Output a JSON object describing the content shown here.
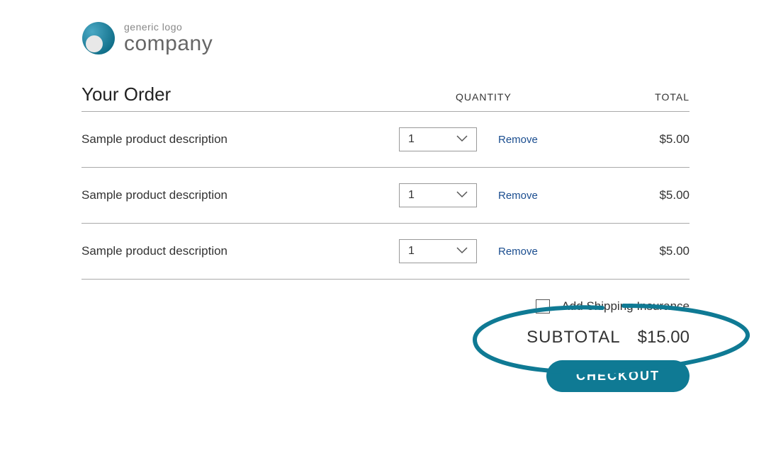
{
  "logo": {
    "small_text": "generic logo",
    "large_text": "company"
  },
  "header": {
    "title": "Your Order",
    "qty_col": "QUANTITY",
    "total_col": "TOTAL"
  },
  "rows": [
    {
      "desc": "Sample product description",
      "qty": "1",
      "remove": "Remove",
      "total": "$5.00"
    },
    {
      "desc": "Sample product description",
      "qty": "1",
      "remove": "Remove",
      "total": "$5.00"
    },
    {
      "desc": "Sample product description",
      "qty": "1",
      "remove": "Remove",
      "total": "$5.00"
    }
  ],
  "insurance": {
    "label": "Add Shipping Insurance"
  },
  "subtotal": {
    "label": "SUBTOTAL",
    "value": "$15.00"
  },
  "checkout": {
    "label": "CHECKOUT"
  }
}
